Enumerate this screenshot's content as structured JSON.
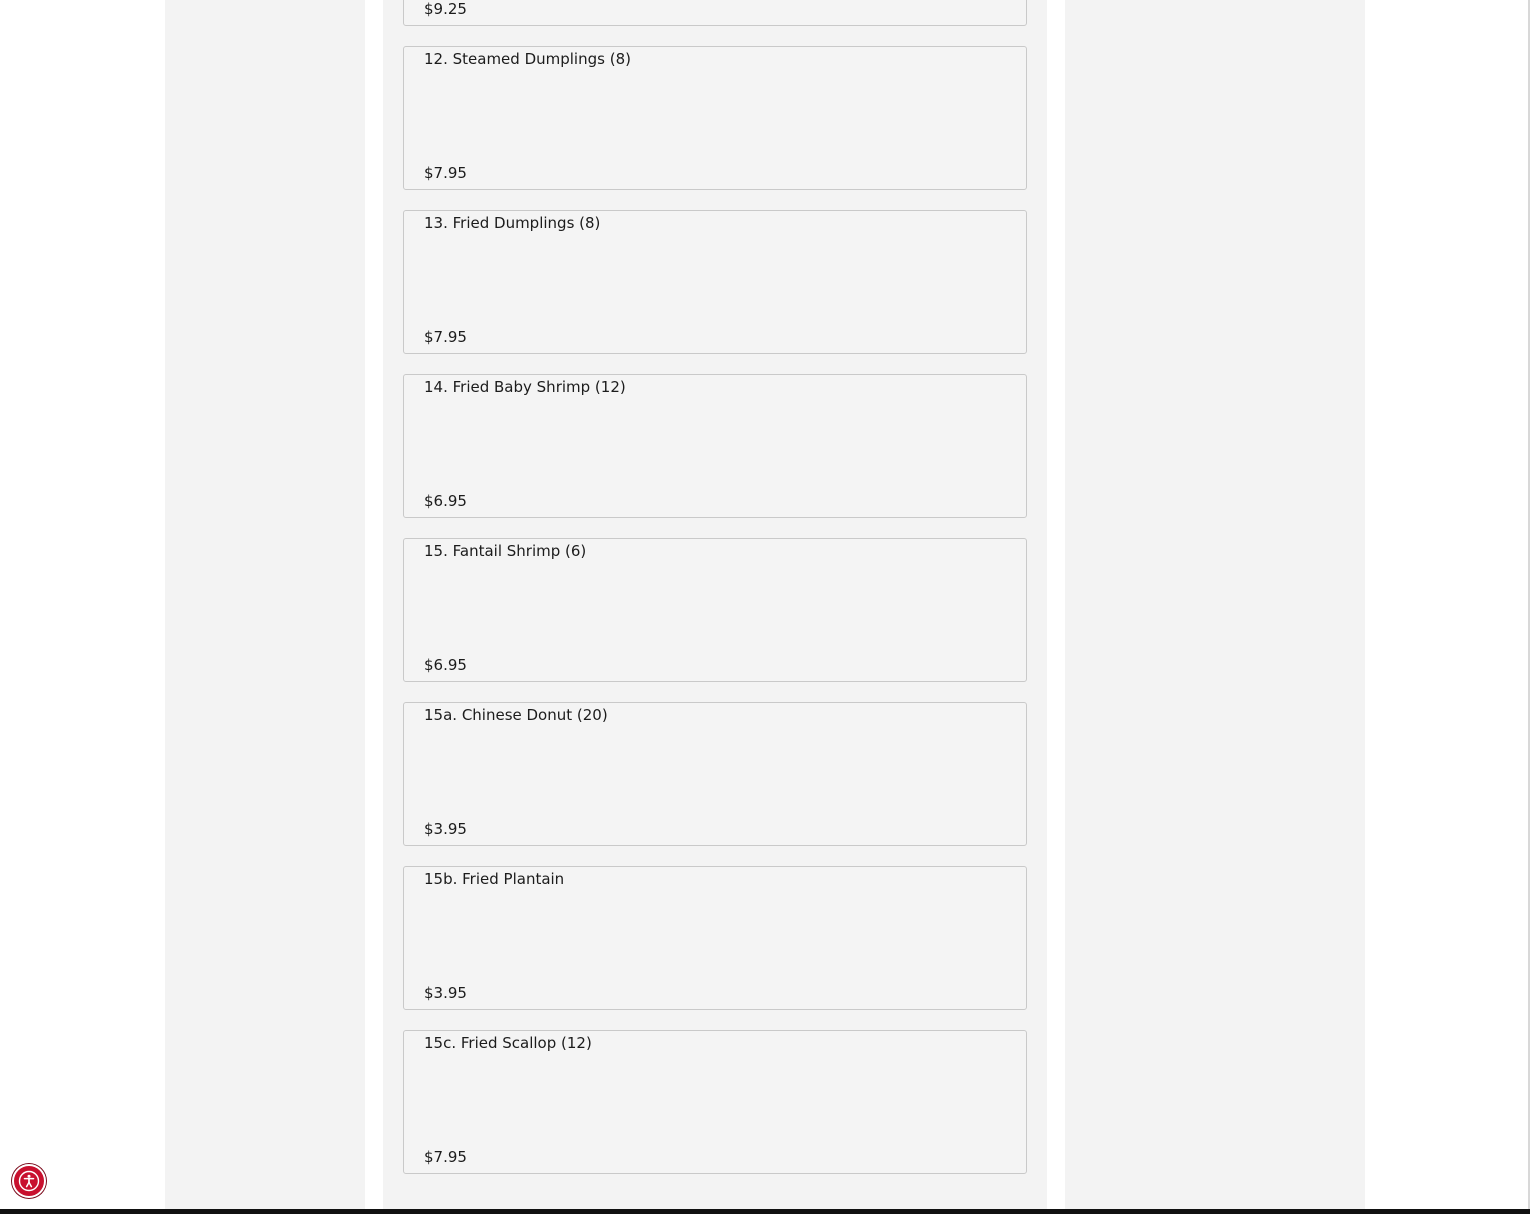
{
  "menu": {
    "items": [
      {
        "name": "",
        "price": "$9.25"
      },
      {
        "name": "12. Steamed Dumplings (8)",
        "price": "$7.95"
      },
      {
        "name": "13. Fried Dumplings (8)",
        "price": "$7.95"
      },
      {
        "name": "14. Fried Baby Shrimp (12)",
        "price": "$6.95"
      },
      {
        "name": "15. Fantail Shrimp (6)",
        "price": "$6.95"
      },
      {
        "name": "15a. Chinese Donut (20)",
        "price": "$3.95"
      },
      {
        "name": "15b. Fried Plantain",
        "price": "$3.95"
      },
      {
        "name": "15c. Fried Scallop (12)",
        "price": "$7.95"
      }
    ]
  },
  "accessibility": {
    "icon": "accessibility-icon"
  },
  "colors": {
    "accent": "#c8102e",
    "card_bg": "#f4f4f4",
    "card_border": "#c9c9c9",
    "column_bg": "#f3f3f3"
  }
}
